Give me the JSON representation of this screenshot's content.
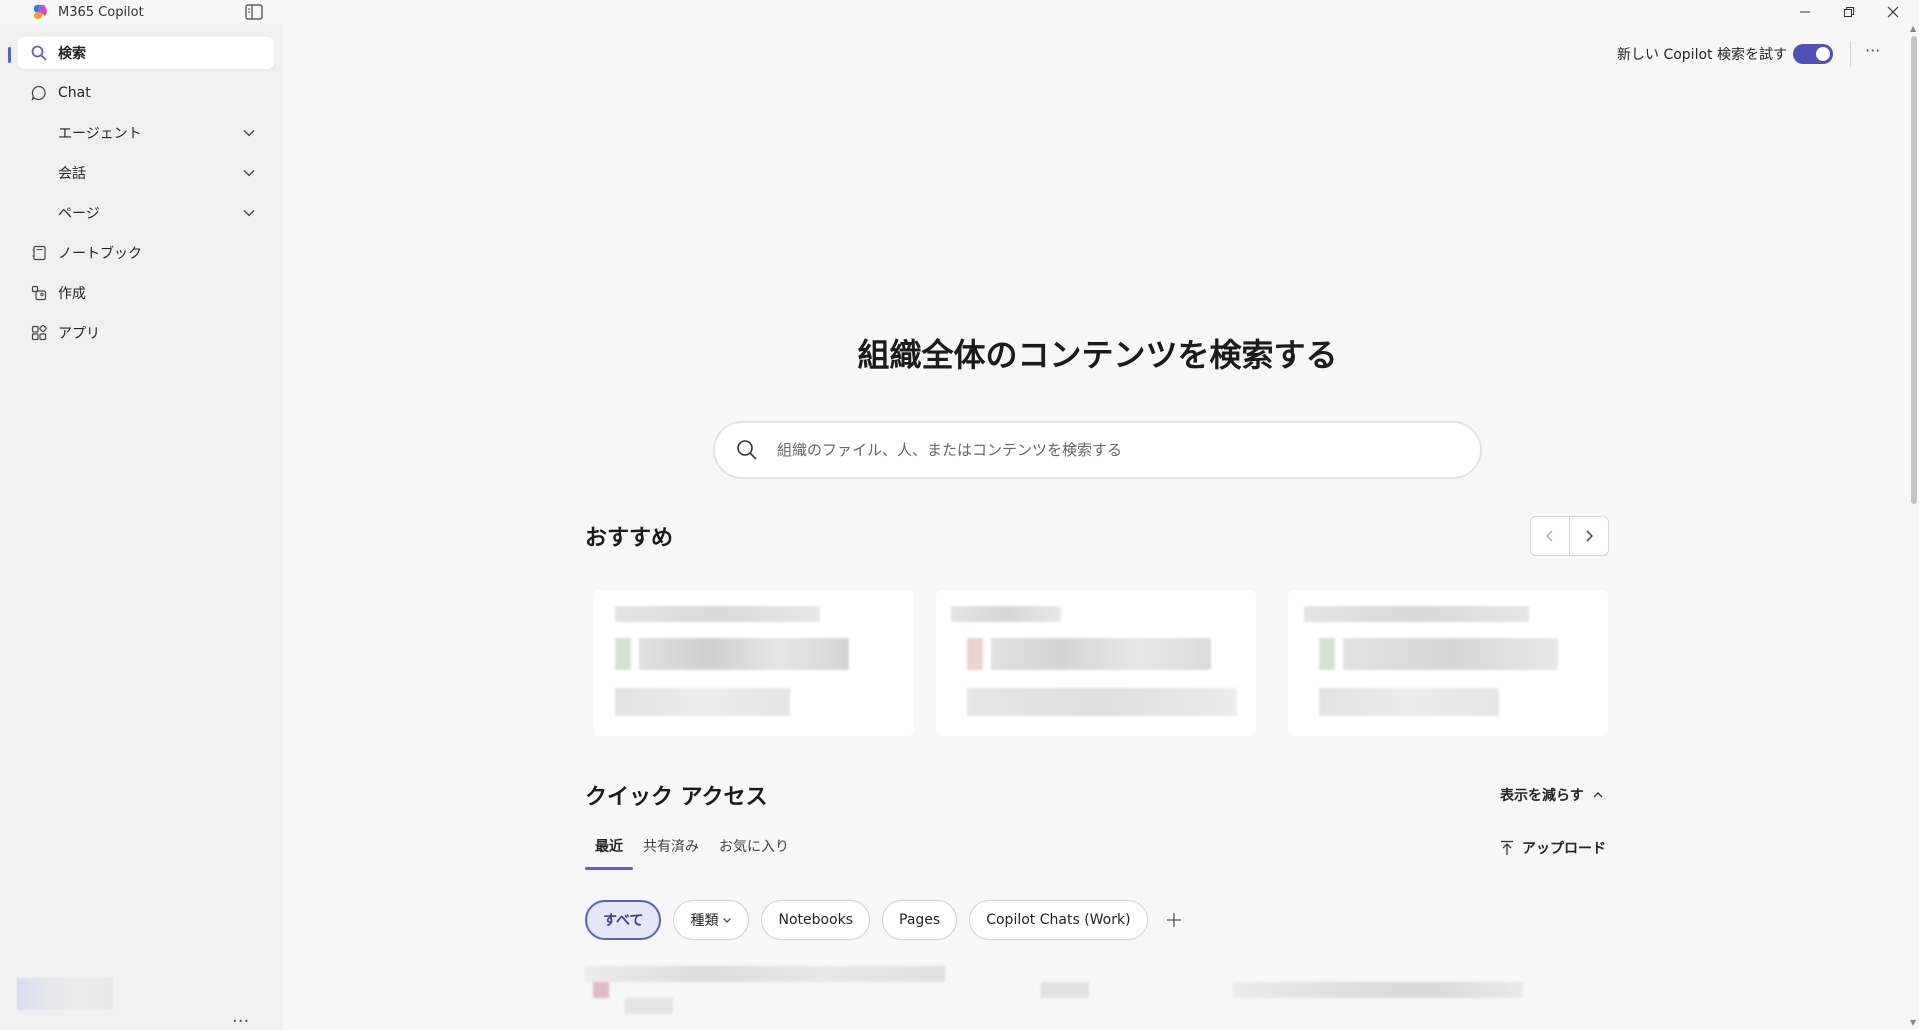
{
  "window": {
    "title": "M365 Copilot"
  },
  "sidebar": {
    "items": [
      {
        "label": "検索",
        "icon": "search-icon",
        "active": true
      },
      {
        "label": "Chat",
        "icon": "chat-icon"
      },
      {
        "label": "エージェント",
        "expandable": true
      },
      {
        "label": "会話",
        "expandable": true
      },
      {
        "label": "ページ",
        "expandable": true
      },
      {
        "label": "ノートブック",
        "icon": "notebook-icon"
      },
      {
        "label": "作成",
        "icon": "create-icon"
      },
      {
        "label": "アプリ",
        "icon": "apps-icon"
      }
    ],
    "more_label": "..."
  },
  "topbar": {
    "toggle_label": "新しい Copilot 検索を試す",
    "toggle_on": true,
    "more_label": "···"
  },
  "hero": {
    "title": "組織全体のコンテンツを検索する",
    "search_placeholder": "組織のファイル、人、またはコンテンツを検索する"
  },
  "recommended": {
    "title": "おすすめ"
  },
  "quick_access": {
    "title": "クイック アクセス",
    "show_less_label": "表示を減らす",
    "tabs": [
      "最近",
      "共有済み",
      "お気に入り"
    ],
    "upload_label": "アップロード",
    "chips": [
      "すべて",
      "種類",
      "Notebooks",
      "Pages",
      "Copilot Chats (Work)"
    ]
  },
  "colors": {
    "accent": "#5b5fc7",
    "toggle": "#4f52b2"
  }
}
